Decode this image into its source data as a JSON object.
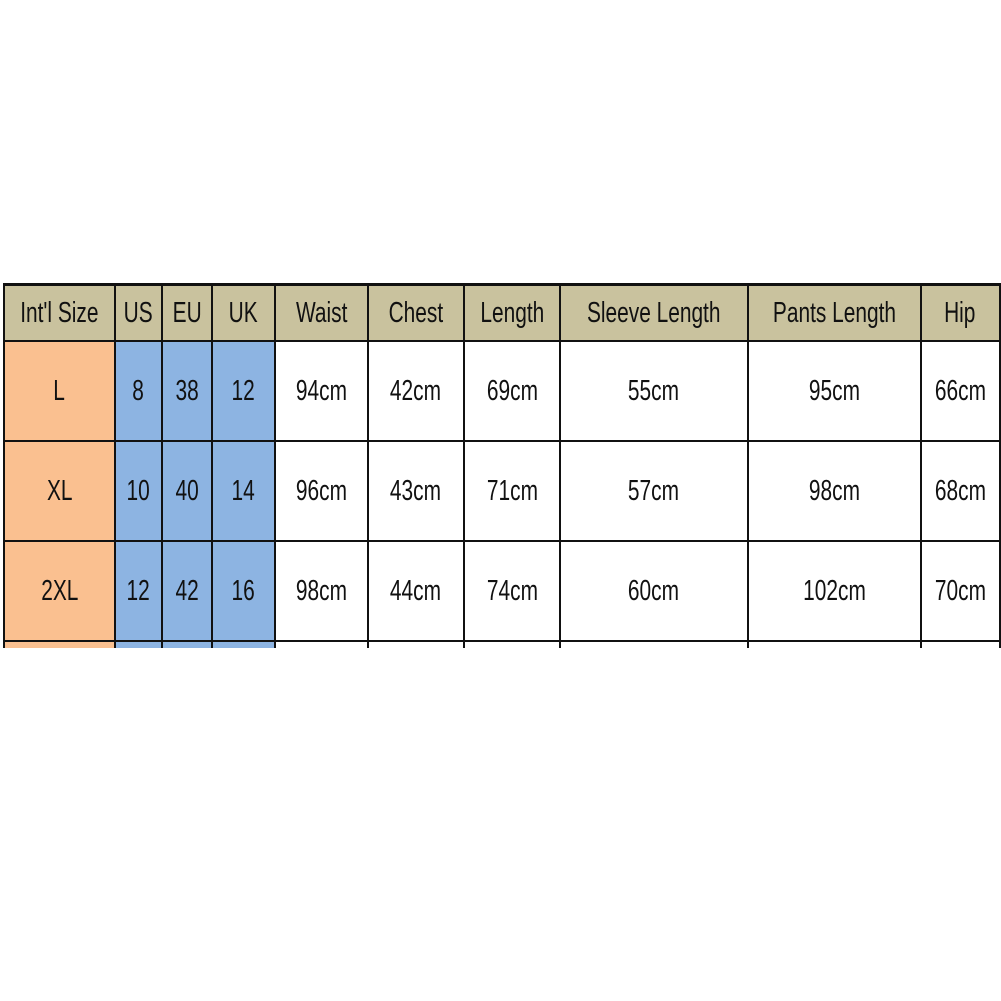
{
  "colors": {
    "header_bg": "#C9C29E",
    "intl_bg": "#FAC090",
    "conversion_bg": "#8DB4E2",
    "cell_bg": "#FFFFFF",
    "border": "#111111"
  },
  "headers": [
    "Int'l Size",
    "US",
    "EU",
    "UK",
    "Waist",
    "Chest",
    "Length",
    "Sleeve Length",
    "Pants Length",
    "Hip"
  ],
  "rows": [
    [
      "L",
      "8",
      "38",
      "12",
      "94cm",
      "42cm",
      "69cm",
      "55cm",
      "95cm",
      "66cm"
    ],
    [
      "XL",
      "10",
      "40",
      "14",
      "96cm",
      "43cm",
      "71cm",
      "57cm",
      "98cm",
      "68cm"
    ],
    [
      "2XL",
      "12",
      "42",
      "16",
      "98cm",
      "44cm",
      "74cm",
      "60cm",
      "102cm",
      "70cm"
    ]
  ]
}
